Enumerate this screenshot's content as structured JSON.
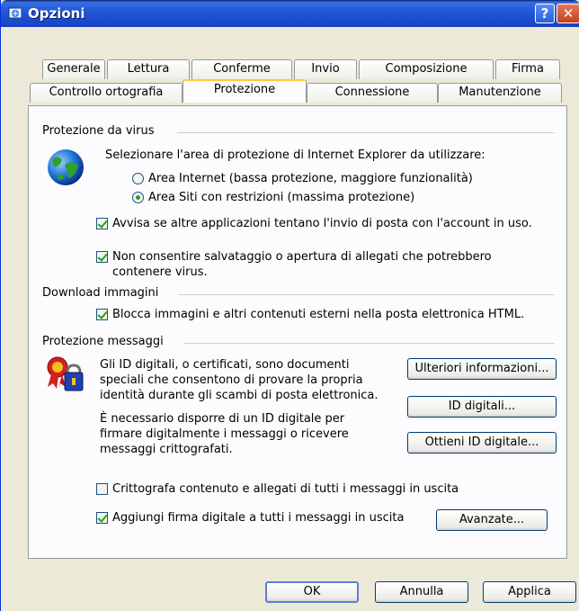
{
  "window": {
    "title": "Opzioni",
    "help_glyph": "?",
    "close_glyph": "✕"
  },
  "tabs_back": [
    "Generale",
    "Lettura",
    "Conferme",
    "Invio",
    "Composizione",
    "Firma"
  ],
  "tabs_front": [
    "Controllo ortografia",
    "Protezione",
    "Connessione",
    "Manutenzione"
  ],
  "active_tab": "Protezione",
  "virus": {
    "group": "Protezione da virus",
    "zone_prompt": "Selezionare l'area di protezione di Internet Explorer da utilizzare:",
    "radio_internet": "Area Internet (bassa protezione, maggiore funzionalità)",
    "radio_restricted": "Area Siti con restrizioni (massima protezione)",
    "warn_send": "Avvisa se altre applicazioni tentano l'invio di posta con l'account in uso.",
    "block_attach_1": "Non consentire salvataggio o apertura di allegati che potrebbero",
    "block_attach_2": "contenere virus."
  },
  "images": {
    "group": "Download immagini",
    "block_images": "Blocca immagini e altri contenuti esterni nella posta elettronica HTML."
  },
  "secure": {
    "group": "Protezione messaggi",
    "desc": [
      "Gli ID digitali, o certificati, sono documenti",
      "speciali che consentono di provare la propria",
      "identità durante gli scambi di posta elettronica."
    ],
    "need": [
      "È necessario disporre di un ID digitale per",
      "firmare digitalmente i messaggi o ricevere",
      "messaggi crittografati."
    ],
    "btn_more": "Ulteriori informazioni...",
    "btn_ids": "ID digitali...",
    "btn_get": "Ottieni ID digitale...",
    "encrypt": "Crittografa contenuto e allegati di tutti i messaggi in uscita",
    "sign": "Aggiungi firma digitale a tutti i messaggi in uscita",
    "btn_adv": "Avanzate..."
  },
  "footer": {
    "ok": "OK",
    "cancel": "Annulla",
    "apply": "Applica"
  },
  "state": {
    "zone_selected": "restricted",
    "warn_send": true,
    "block_attach": true,
    "block_images": true,
    "encrypt": false,
    "sign": true
  },
  "colors": {
    "titlebar": "#2258d8",
    "accent_tab": "#ffc83c",
    "check": "#21a121"
  },
  "icons": [
    "window-icon",
    "globe-icon",
    "certificate-lock-icon"
  ]
}
